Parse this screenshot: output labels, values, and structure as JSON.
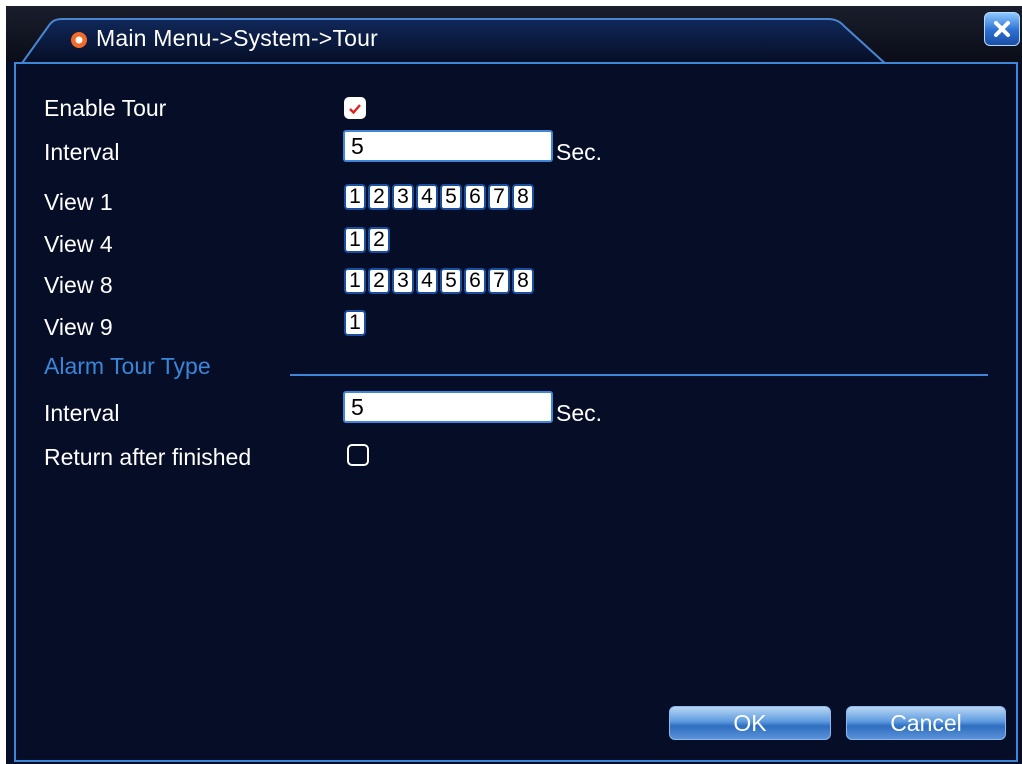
{
  "window": {
    "title": "Main Menu->System->Tour",
    "accent": "#3f86d8",
    "background": "#060d26",
    "title_icon": "gear-icon",
    "close_icon": "close-icon"
  },
  "form": {
    "enable_tour": {
      "label": "Enable Tour",
      "checked": true
    },
    "interval": {
      "label": "Interval",
      "value": "5",
      "unit": "Sec."
    },
    "views": [
      {
        "label": "View 1",
        "channels": [
          "1",
          "2",
          "3",
          "4",
          "5",
          "6",
          "7",
          "8"
        ]
      },
      {
        "label": "View 4",
        "channels": [
          "1",
          "2"
        ]
      },
      {
        "label": "View 8",
        "channels": [
          "1",
          "2",
          "3",
          "4",
          "5",
          "6",
          "7",
          "8"
        ]
      },
      {
        "label": "View 9",
        "channels": [
          "1"
        ]
      }
    ],
    "alarm_section": {
      "label": "Alarm Tour Type"
    },
    "alarm_interval": {
      "label": "Interval",
      "value": "5",
      "unit": "Sec."
    },
    "return_after_finished": {
      "label": "Return after finished",
      "checked": false
    }
  },
  "buttons": {
    "ok": "OK",
    "cancel": "Cancel"
  }
}
